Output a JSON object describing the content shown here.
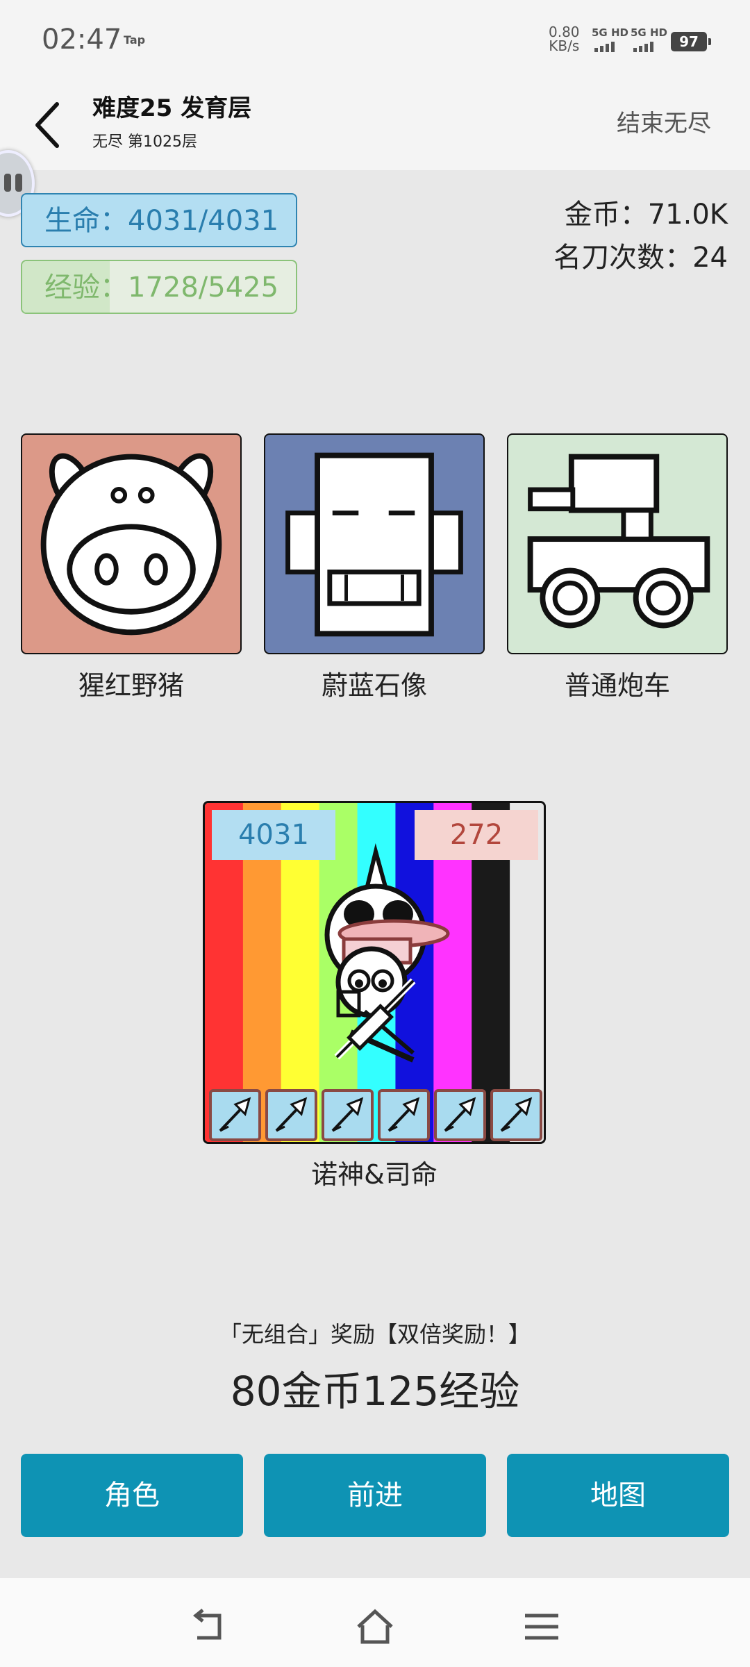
{
  "status_bar": {
    "time": "02:47",
    "tap_badge": "Tap",
    "net_speed": "0.80",
    "net_unit": "KB/s",
    "sim1": "5G HD",
    "sim2": "5G HD",
    "battery": "97"
  },
  "header": {
    "title": "难度25 发育层",
    "subtitle": "无尽 第1025层",
    "end_button": "结束无尽"
  },
  "player": {
    "hp": "生命：4031/4031",
    "xp": "经验：1728/5425",
    "xp_progress": 0.319,
    "gold": "金币：71.0K",
    "blade_count": "名刀次数：24"
  },
  "enemies": [
    {
      "name": "猩红野猪",
      "icon": "pig-icon",
      "color": "#dc9988"
    },
    {
      "name": "蔚蓝石像",
      "icon": "stone-statue-icon",
      "color": "#6c81b2"
    },
    {
      "name": "普通炮车",
      "icon": "cannon-cart-icon",
      "color": "#d4e8d4"
    }
  ],
  "hero": {
    "hp": "4031",
    "attack": "272",
    "name": "诺神&司命",
    "equipment": [
      "arrow-icon",
      "arrow-icon",
      "arrow-icon",
      "arrow-icon",
      "arrow-icon",
      "arrow-icon"
    ],
    "rainbow": [
      "#ff3333",
      "#ff9933",
      "#ffff33",
      "#aaff66",
      "#33ffff",
      "#1111dd",
      "#ff33ff",
      "#1a1a1a",
      "#e8e8e8"
    ]
  },
  "reward": {
    "line": "「无组合」奖励【双倍奖励！】",
    "main": "80金币125经验"
  },
  "buttons": {
    "character": "角色",
    "advance": "前进",
    "map": "地图"
  },
  "colors": {
    "button": "#0e93b4",
    "hp_bg": "#b3def2",
    "hp_text": "#2a7eae",
    "xp_text": "#7fb86d",
    "atk_bg": "#f5d4d0",
    "atk_text": "#b2463c"
  }
}
